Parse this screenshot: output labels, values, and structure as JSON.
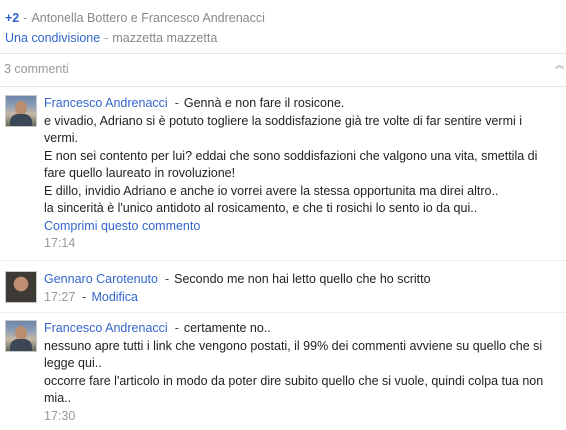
{
  "header": {
    "plus_count": "+2",
    "sharers": "Antonella Bottero e Francesco Andrenacci",
    "share_link": "Una condivisione",
    "sharer_name": "mazzetta mazzetta"
  },
  "comments_bar": {
    "count_label": "3 commenti",
    "collapse_icon": "double-chevron-up-icon"
  },
  "comments": [
    {
      "author": "Francesco Andrenacci",
      "first_line": "Gennà e non fare il rosicone.",
      "lines": [
        "e vivadio, Adriano si è potuto togliere la soddisfazione già tre volte di far sentire vermi i",
        "vermi.",
        "E non sei contento per lui? eddai che sono soddisfazioni che valgono una vita, smettila di",
        "fare quello laureato in rovoluzione!",
        "E dillo, invidio Adriano e anche io vorrei avere la stessa opportunita ma direi altro..",
        "la sincerità è l'unico antidoto al rosicamento, e che ti rosichi lo sento io da qui.."
      ],
      "expand_link": "Comprimi questo commento",
      "time": "17:14"
    },
    {
      "author": "Gennaro Carotenuto",
      "first_line": "Secondo me non hai letto quello che ho scritto",
      "time": "17:27",
      "edit_link": "Modifica"
    },
    {
      "author": "Francesco Andrenacci",
      "first_line": "certamente no..",
      "lines": [
        "nessuno apre tutti i link che vengono postati, il 99% dei commenti avviene su quello che si",
        "legge qui..",
        "occorre fare l'articolo in modo da poter dire subito quello che si vuole, quindi colpa tua non",
        "mia.."
      ],
      "time": "17:30"
    }
  ]
}
